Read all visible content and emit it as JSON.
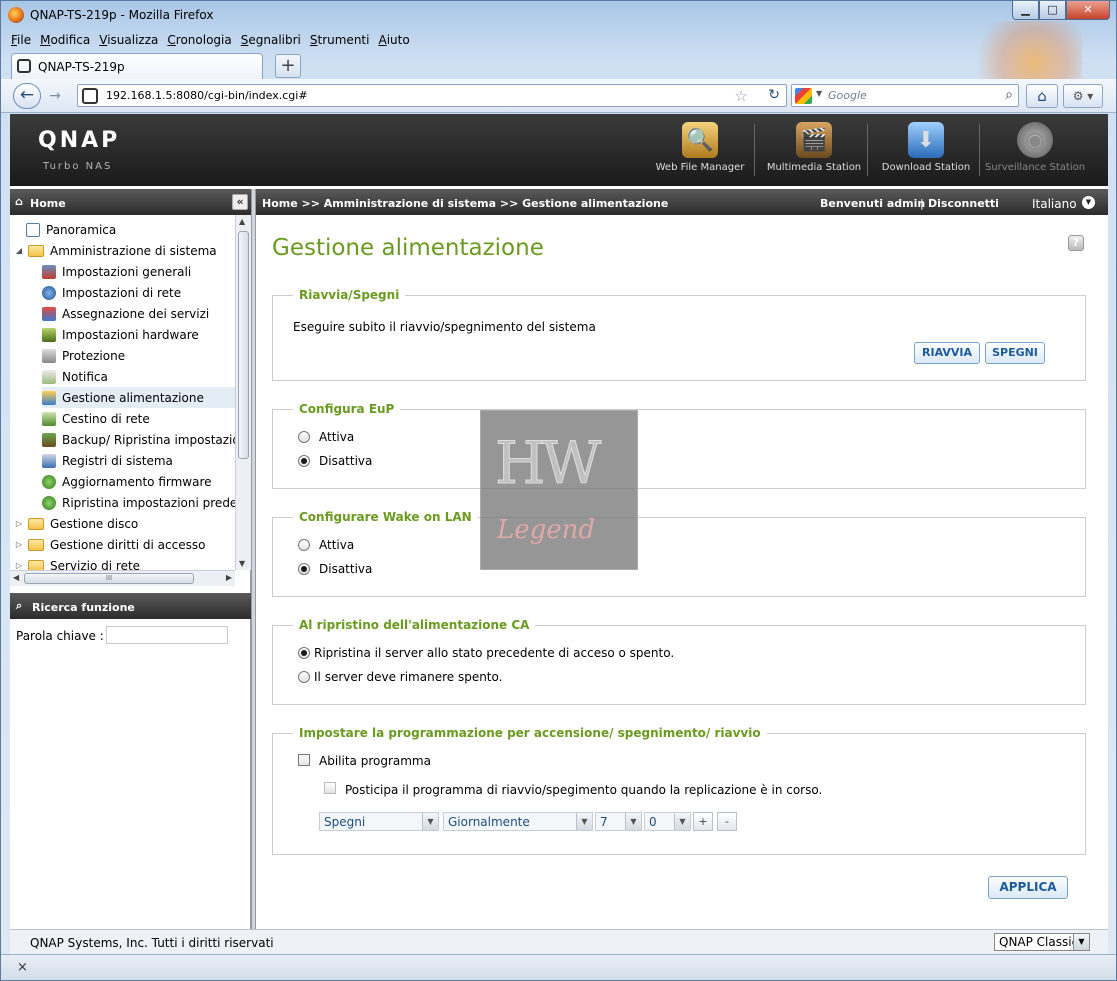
{
  "window": {
    "title": "QNAP-TS-219p - Mozilla Firefox",
    "controls": {
      "minimize": "▁",
      "maximize": "□",
      "close": "✕"
    }
  },
  "menu": [
    "File",
    "Modifica",
    "Visualizza",
    "Cronologia",
    "Segnalibri",
    "Strumenti",
    "Aiuto"
  ],
  "tab": {
    "label": "QNAP-TS-219p",
    "new_tab": "+"
  },
  "nav": {
    "url": "192.168.1.5:8080/cgi-bin/index.cgi#",
    "search_placeholder": "Google"
  },
  "header": {
    "logo": "QNAP",
    "subtitle": "Turbo NAS",
    "stations": [
      "Web File Manager",
      "Multimedia Station",
      "Download Station",
      "Surveillance Station"
    ]
  },
  "sidebar": {
    "home": "Home",
    "items": [
      {
        "label": "Panoramica",
        "level": 1
      },
      {
        "label": "Amministrazione di sistema",
        "level": 0,
        "folder": true,
        "expanded": true
      },
      {
        "label": "Impostazioni generali",
        "level": 2
      },
      {
        "label": "Impostazioni di rete",
        "level": 2
      },
      {
        "label": "Assegnazione dei servizi",
        "level": 2
      },
      {
        "label": "Impostazioni hardware",
        "level": 2
      },
      {
        "label": "Protezione",
        "level": 2
      },
      {
        "label": "Notifica",
        "level": 2
      },
      {
        "label": "Gestione alimentazione",
        "level": 2,
        "selected": true
      },
      {
        "label": "Cestino di rete",
        "level": 2
      },
      {
        "label": "Backup/ Ripristina impostazioni",
        "level": 2
      },
      {
        "label": "Registri di sistema",
        "level": 2
      },
      {
        "label": "Aggiornamento firmware",
        "level": 2
      },
      {
        "label": "Ripristina impostazioni predefinite",
        "level": 2
      },
      {
        "label": "Gestione disco",
        "level": 0,
        "folder": true
      },
      {
        "label": "Gestione diritti di accesso",
        "level": 0,
        "folder": true
      },
      {
        "label": "Servizio di rete",
        "level": 0,
        "folder": true
      }
    ],
    "search_title": "Ricerca funzione",
    "keyword_label": "Parola chiave :",
    "keyword_value": ""
  },
  "topbar": {
    "breadcrumb": "Home >> Amministrazione di sistema >> Gestione alimentazione",
    "welcome": "Benvenuti admin",
    "separator": "|",
    "logout": "Disconnetti",
    "language": "Italiano"
  },
  "page": {
    "title": "Gestione alimentazione",
    "help": "?",
    "restart": {
      "legend": "Riavvia/Spegni",
      "desc": "Eseguire subito il riavvio/spegnimento del sistema",
      "restart_label": "RIAVVIA",
      "shutdown_label": "SPEGNI"
    },
    "eup": {
      "legend": "Configura EuP",
      "options": [
        "Attiva",
        "Disattiva"
      ],
      "selected": 1
    },
    "wol": {
      "legend": "Configurare Wake on LAN",
      "options": [
        "Attiva",
        "Disattiva"
      ],
      "selected": 1
    },
    "ac": {
      "legend": "Al ripristino dell'alimentazione CA",
      "options": [
        "Ripristina il server allo stato precedente di acceso o spento.",
        "Il server deve rimanere spento."
      ],
      "selected": 0
    },
    "schedule": {
      "legend": "Impostare la programmazione per accensione/ spegnimento/ riavvio",
      "enable_label": "Abilita programma",
      "enable_checked": false,
      "postpone_label": "Posticipa il programma di riavvio/spegimento quando la replicazione è in corso.",
      "postpone_checked": false,
      "action": "Spegni",
      "frequency": "Giornalmente",
      "hour": "7",
      "minute": "0",
      "add": "+",
      "remove": "-"
    },
    "apply_label": "APPLICA"
  },
  "watermark": {
    "top": "HW",
    "bottom": "Legend"
  },
  "footer": {
    "copyright": "QNAP Systems, Inc. Tutti i diritti riservati",
    "theme": "QNAP Classic"
  },
  "status": {
    "close": "×"
  }
}
